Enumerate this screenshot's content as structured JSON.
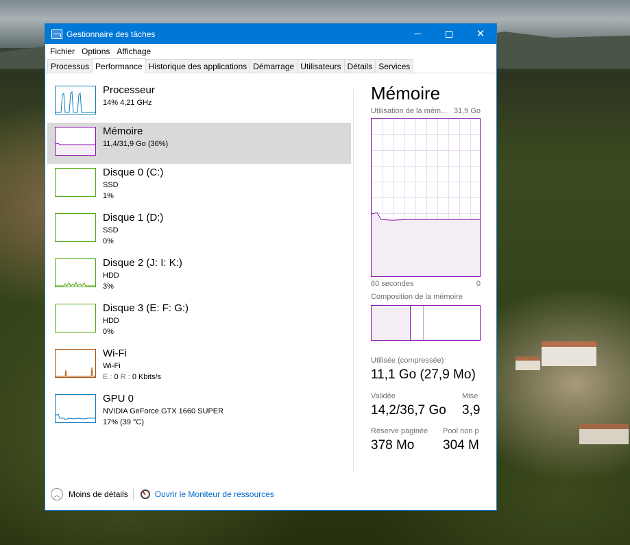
{
  "window": {
    "title": "Gestionnaire des tâches",
    "controls": {
      "minimize": "minimize-icon",
      "maximize": "maximize-icon",
      "close": "close-icon"
    }
  },
  "menu": [
    "Fichier",
    "Options",
    "Affichage"
  ],
  "tabs": [
    {
      "label": "Processus",
      "active": false
    },
    {
      "label": "Performance",
      "active": true
    },
    {
      "label": "Historique des applications",
      "active": false
    },
    {
      "label": "Démarrage",
      "active": false
    },
    {
      "label": "Utilisateurs",
      "active": false
    },
    {
      "label": "Détails",
      "active": false
    },
    {
      "label": "Services",
      "active": false
    }
  ],
  "performance_items": [
    {
      "name": "Processeur",
      "line1": "14% 4,21 GHz",
      "color": "#117dbb"
    },
    {
      "name": "Mémoire",
      "line1": "11,4/31,9 Go (36%)",
      "color": "#8b12ae",
      "selected": true
    },
    {
      "name": "Disque 0 (C:)",
      "line1": "SSD",
      "line2": "1%",
      "color": "#4da60c"
    },
    {
      "name": "Disque 1 (D:)",
      "line1": "SSD",
      "line2": "0%",
      "color": "#4da60c"
    },
    {
      "name": "Disque 2 (J: I: K:)",
      "line1": "HDD",
      "line2": "3%",
      "color": "#4da60c"
    },
    {
      "name": "Disque 3 (E: F: G:)",
      "line1": "HDD",
      "line2": "0%",
      "color": "#4da60c"
    },
    {
      "name": "Wi-Fi",
      "line1": "Wi-Fi",
      "line2_prefix_e": "E : ",
      "line2_val_e": "0",
      "line2_prefix_r": " R : ",
      "line2_val_r": "0 Kbits/s",
      "color": "#a74f01"
    },
    {
      "name": "GPU 0",
      "line1": "NVIDIA GeForce GTX 1660 SUPER",
      "line2": "17% (39 °C)",
      "color": "#117dbb"
    }
  ],
  "detail": {
    "title": "Mémoire",
    "usage_label": "Utilisation de la mém...",
    "total": "31,9 Go",
    "axis_left": "60 secondes",
    "axis_right": "0",
    "composition_label": "Composition de la mémoire",
    "usage_level": 0.36,
    "composition": {
      "in_use": 0.36,
      "modified": 0.01
    },
    "stats": {
      "used_label": "Utilisée (compressée)",
      "used_value": "11,1 Go (27,9 Mo)",
      "committed_label": "Validée",
      "committed_value": "14,2/36,7 Go",
      "cached_label": "Mise",
      "cached_value": "3,9",
      "paged_label": "Réserve paginée",
      "paged_value": "378 Mo",
      "nonpaged_label": "Pool non p",
      "nonpaged_value": "304 M"
    }
  },
  "footer": {
    "fewer_details": "Moins de détails",
    "open_monitor": "Ouvrir le Moniteur de ressources"
  }
}
